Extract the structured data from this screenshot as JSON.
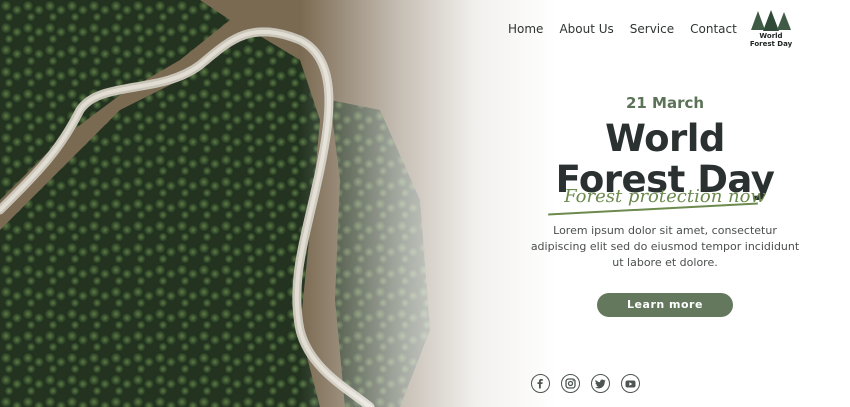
{
  "nav": {
    "items": [
      "Home",
      "About Us",
      "Service",
      "Contact"
    ]
  },
  "logo": {
    "line1": "World",
    "line2": "Forest Day",
    "icon": "pine-trees-icon"
  },
  "hero": {
    "date": "21 March",
    "title_line1": "World",
    "title_line2": "Forest Day",
    "tagline": "Forest protection now",
    "description": "Lorem ipsum dolor sit amet, consectetur adipiscing elit sed do eiusmod tempor incididunt ut labore et dolore.",
    "cta_label": "Learn more"
  },
  "social": [
    "facebook-icon",
    "instagram-icon",
    "twitter-icon",
    "youtube-icon"
  ],
  "colors": {
    "accent": "#63785c",
    "date": "#5b7357",
    "script": "#6c8a4d",
    "text": "#2b3130"
  }
}
